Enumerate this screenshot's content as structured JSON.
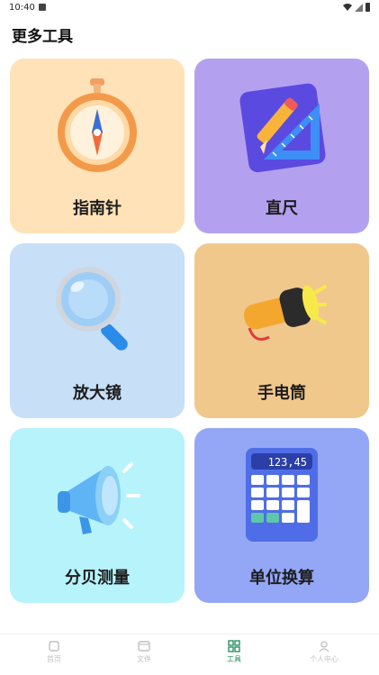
{
  "status_bar": {
    "time": "10:40"
  },
  "header": {
    "title": "更多工具"
  },
  "tools": [
    {
      "label": "指南针",
      "icon": "compass-icon"
    },
    {
      "label": "直尺",
      "icon": "ruler-icon"
    },
    {
      "label": "放大镜",
      "icon": "magnifier-icon"
    },
    {
      "label": "手电筒",
      "icon": "flashlight-icon"
    },
    {
      "label": "分贝测量",
      "icon": "megaphone-icon"
    },
    {
      "label": "单位换算",
      "icon": "calculator-icon",
      "screen_text": "123,45"
    }
  ],
  "tab_bar": {
    "items": [
      {
        "label": "首页",
        "icon": "home-icon",
        "active": false
      },
      {
        "label": "文件",
        "icon": "file-icon",
        "active": false
      },
      {
        "label": "工具",
        "icon": "tools-icon",
        "active": true
      },
      {
        "label": "个人中心",
        "icon": "user-icon",
        "active": false
      }
    ]
  },
  "colors": {
    "compass_card": "#ffe2b7",
    "ruler_card": "#b3a1f0",
    "magnifier_card": "#c7dff7",
    "flashlight_card": "#f1c88c",
    "decibel_card": "#b6f3fa",
    "unit_card": "#94a6f6",
    "active_tab": "#1a8a5a"
  }
}
